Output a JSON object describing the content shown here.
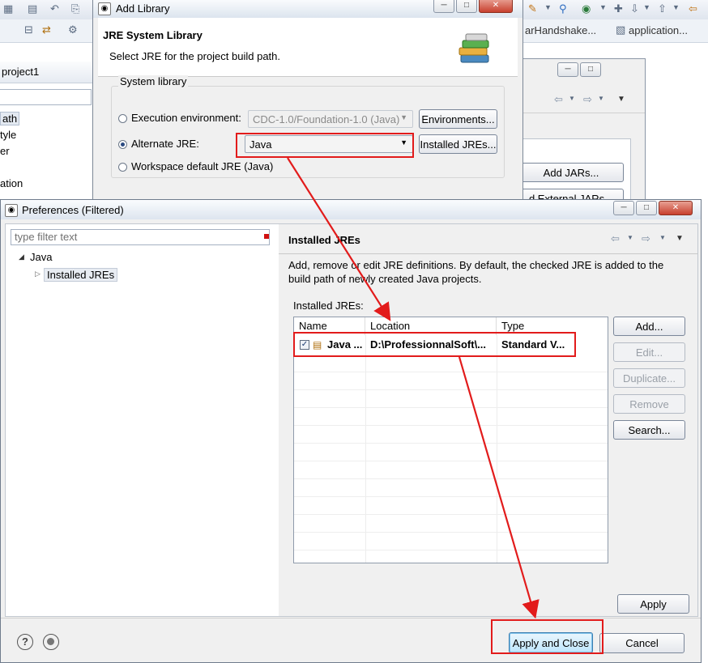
{
  "eclipse": {
    "tabs": [
      "arHandshake...",
      "application..."
    ],
    "left_panel_title": "project1",
    "left_items": [
      "ath",
      "tyle",
      "er",
      "ation"
    ]
  },
  "build_path": {
    "add_jars": "Add JARs...",
    "add_external_jars": "d External JARs..."
  },
  "add_library": {
    "title": "Add Library",
    "heading": "JRE System Library",
    "subheading": "Select JRE for the project build path.",
    "group_label": "System library",
    "exec_env_label": "Execution environment:",
    "exec_env_value": "CDC-1.0/Foundation-1.0 (Java)",
    "environments_btn": "Environments...",
    "alt_jre_label": "Alternate JRE:",
    "alt_jre_value": "Java",
    "installed_jres_btn": "Installed JREs...",
    "workspace_label": "Workspace default JRE (Java)"
  },
  "preferences": {
    "title": "Preferences (Filtered)",
    "filter_placeholder": "type filter text",
    "tree": {
      "root": "Java",
      "child": "Installed JREs"
    },
    "page_title": "Installed JREs",
    "description": "Add, remove or edit JRE definitions. By default, the checked JRE is added to the build path of newly created Java projects.",
    "table_label": "Installed JREs:",
    "columns": [
      "Name",
      "Location",
      "Type"
    ],
    "rows": [
      {
        "name": "Java ...",
        "location": "D:\\ProfessionnalSoft\\...",
        "type": "Standard V...",
        "checked": true
      }
    ],
    "buttons": {
      "add": "Add...",
      "edit": "Edit...",
      "duplicate": "Duplicate...",
      "remove": "Remove",
      "search": "Search...",
      "apply": "Apply",
      "apply_close": "Apply and Close",
      "cancel": "Cancel"
    }
  },
  "colors": {
    "annotation": "#e21b1b",
    "dialog_bg": "#f0f0f0"
  }
}
